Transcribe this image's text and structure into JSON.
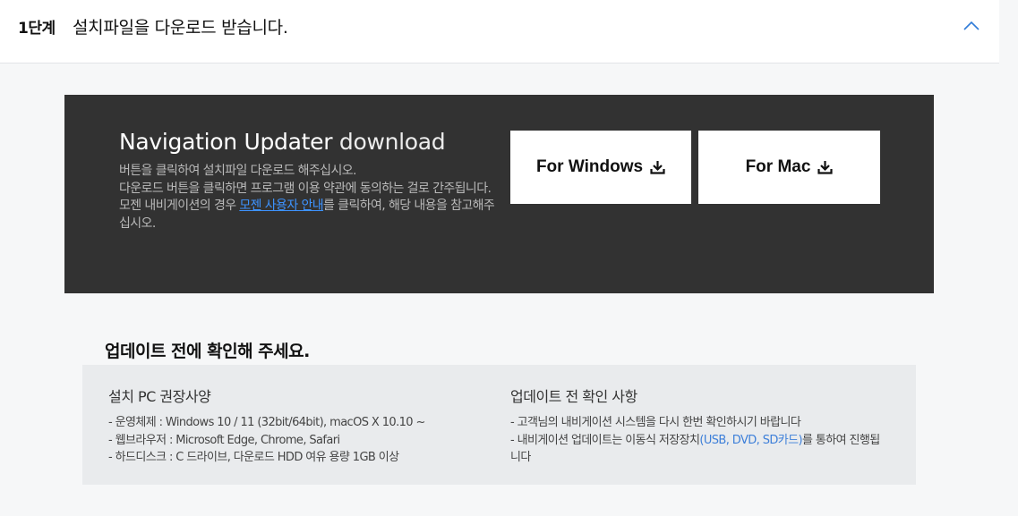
{
  "step": {
    "number": "1단계",
    "title": "설치파일을 다운로드 받습니다."
  },
  "download": {
    "title_main": "Navigation Updater",
    "title_sub": "download",
    "desc_line1": "버튼을 클릭하여 설치파일 다운로드 해주십시오.",
    "desc_line2": "다운로드 버튼을 클릭하면 프로그램 이용 약관에 동의하는 걸로 간주됩니다.",
    "desc_line3_pre": "모젠 내비게이션의 경우 ",
    "desc_line3_link": "모젠 사용자 안내",
    "desc_line3_post": "를 클릭하여, 해당 내용을 참고해주십시오.",
    "windows_label": "For Windows",
    "mac_label": "For Mac"
  },
  "notice": {
    "title": "업데이트 전에 확인해 주세요.",
    "left": {
      "heading": "설치 PC 권장사양",
      "lines": [
        "- 운영체제 : Windows 10 / 11 (32bit/64bit), macOS X 10.10 ~",
        "- 웹브라우저 : Microsoft Edge, Chrome, Safari",
        "- 하드디스크 : C 드라이브, 다운로드 HDD 여유 용량 1GB 이상"
      ]
    },
    "right": {
      "heading": "업데이트 전 확인 사항",
      "line1": "- 고객님의 내비게이션 시스템을 다시 한번 확인하시기 바랍니다",
      "line2_pre": "- 내비게이션 업데이트는 이동식 저장장치",
      "line2_hl": "(USB, DVD, SD카드)",
      "line2_post": "를 통하여 진행됩니다"
    }
  },
  "colors": {
    "panel_bg": "#323232",
    "link": "#3d93ff",
    "accent": "#2f7bd8"
  }
}
